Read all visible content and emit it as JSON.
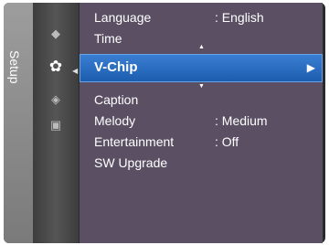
{
  "side_tab": {
    "label": "Setup"
  },
  "icons": [
    {
      "name": "picture-icon",
      "glyph": "◆"
    },
    {
      "name": "setup-gear-icon",
      "glyph": "✿"
    },
    {
      "name": "channel-icon",
      "glyph": "◈"
    },
    {
      "name": "input-icon",
      "glyph": "▣"
    }
  ],
  "menu": {
    "items": [
      {
        "label": "Language",
        "value": ": English"
      },
      {
        "label": "Time",
        "value": ""
      },
      {
        "label": "V-Chip",
        "value": "",
        "selected": true
      },
      {
        "label": "Caption",
        "value": ""
      },
      {
        "label": "Melody",
        "value": ": Medium"
      },
      {
        "label": "Entertainment",
        "value": ": Off"
      },
      {
        "label": "SW Upgrade",
        "value": ""
      }
    ],
    "selected_arrow": "▶",
    "scroll_up": "▲",
    "scroll_down": "▼"
  },
  "colors": {
    "highlight": "#2b6cc4",
    "menu_bg": "#5a4f63"
  }
}
